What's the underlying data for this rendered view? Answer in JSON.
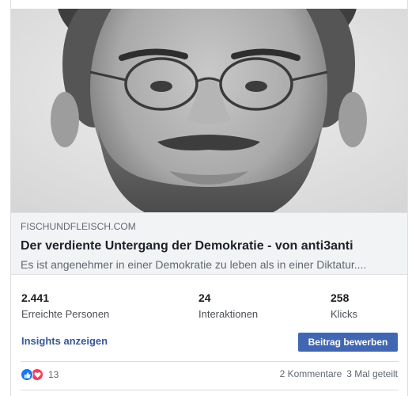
{
  "link_preview": {
    "domain": "FISCHUNDFLEISCH.COM",
    "headline": "Der verdiente Untergang der Demokratie - von anti3anti",
    "description": "Es ist angenehmer in einer Demokratie zu leben als in einer Diktatur...."
  },
  "stats": [
    {
      "value": "2.441",
      "label": "Erreichte Personen"
    },
    {
      "value": "24",
      "label": "Interaktionen"
    },
    {
      "value": "258",
      "label": "Klicks"
    }
  ],
  "actions": {
    "insights_label": "Insights anzeigen",
    "boost_label": "Beitrag bewerben"
  },
  "engagement": {
    "reaction_icons": [
      "like-icon",
      "love-icon"
    ],
    "reaction_count": "13",
    "comments": "2 Kommentare",
    "shares": "3 Mal geteilt"
  },
  "colors": {
    "link_blue": "#385898",
    "button_blue": "#4267b2",
    "like_blue": "#1877f2",
    "love_red": "#f33e58"
  }
}
